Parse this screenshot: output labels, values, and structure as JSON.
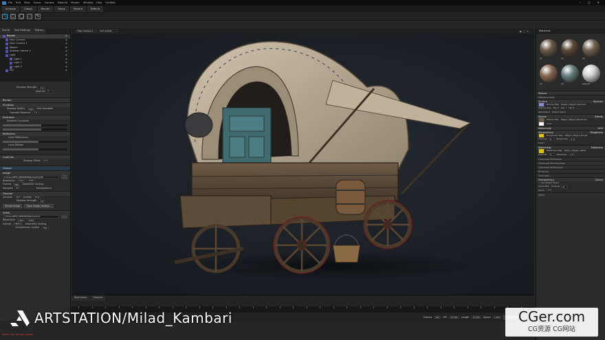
{
  "app": {
    "menu": [
      "File",
      "Edit",
      "View",
      "Scene",
      "Camera",
      "Material",
      "Render",
      "Window",
      "Help",
      "Untitled"
    ],
    "tabs": [
      "Animate",
      "Classic",
      "Render",
      "Setup",
      "Texture",
      "Default"
    ]
  },
  "left_panel": {
    "tabs": [
      "Scene",
      "Tool Settings",
      "History"
    ],
    "tree": [
      {
        "label": "Render",
        "selected": true
      },
      {
        "label": "Main Camera",
        "selected": false
      },
      {
        "label": "Main Camera 1",
        "selected": false
      },
      {
        "label": "Wagon",
        "selected": false
      },
      {
        "label": "Shadow Catcher 1",
        "selected": false
      },
      {
        "label": "Light",
        "selected": false
      },
      {
        "label": "Light 1",
        "selected": false
      },
      {
        "label": "Light 2",
        "selected": false
      },
      {
        "label": "Light 3",
        "selected": false
      },
      {
        "label": "Sky",
        "selected": false
      }
    ],
    "denoise": {
      "label": "Denoise Strength",
      "value": "1.0",
      "start_label": "Start At",
      "start_value": "1"
    },
    "sections": {
      "render": "Render",
      "shadows": "Shadows",
      "exclusion": "Exclusion",
      "reflection": "Reflection",
      "common": "Common",
      "output": "Output",
      "image": "Image",
      "video": "Video"
    },
    "shadow_quality": {
      "label": "Shadow Quality",
      "value": "High",
      "check": "Use Cascades"
    },
    "cascade": {
      "label": "Cascade Distance",
      "value": "1.0"
    },
    "ambient": "Ambient Occlusion",
    "local_refl": "Local Reflections",
    "local_diffuse": "Local Diffuse",
    "shadow_offset": {
      "label": "Shadow Offset",
      "value": "0.0"
    },
    "output_path": "C:/Users/EFM_RENDERING/Desktop/Mi",
    "resolution": {
      "label": "Resolution",
      "w": "1920",
      "h": "1080"
    },
    "format": {
      "label": "Format",
      "value": "PNG",
      "check": "Geometric Sorting"
    },
    "samples": {
      "label": "Samples",
      "value": "64",
      "check": "Transparency"
    },
    "denoise_row": {
      "label": "Denoise",
      "device": "CPU",
      "quality_label": "Quality",
      "quality": "High"
    },
    "denoise_strength": {
      "label": "Denoise Strength",
      "value": "1.0"
    },
    "buttons": {
      "render_image": "Render Image",
      "open_location": "Open Image Location..."
    },
    "video_path": "C:/Users/EFM_RENDERING/Desktop",
    "video_res": {
      "label": "Resolution",
      "w": "1920",
      "h": "1080"
    },
    "video_format": {
      "label": "Format",
      "value": "MPEG4",
      "check": "Geometric Sorting"
    },
    "compression": {
      "label": "Compression Quality",
      "value": "High"
    }
  },
  "viewport": {
    "camera": "Main Camera 1",
    "quality": "Full Quality"
  },
  "timeline": {
    "tabs": [
      "Keyframes",
      "Timeline"
    ],
    "frames_label": "Frames",
    "frames": "300",
    "fps_label": "FPS",
    "fps": "30.000",
    "length_label": "Length",
    "length": "10.000",
    "speed_label": "Speed",
    "speed": "1.000",
    "bake": "Bake Speed"
  },
  "right_panel": {
    "title": "Materials",
    "materials": [
      {
        "label": "01",
        "color": "#6b5a4a"
      },
      {
        "label": "02",
        "color": "#5c4a3a"
      },
      {
        "label": "03",
        "color": "#736252"
      },
      {
        "label": "04",
        "color": "#8a6a55"
      },
      {
        "label": "05",
        "color": "#6a8080"
      },
      {
        "label": "Default",
        "color": "#d0d0d0"
      }
    ],
    "sections": [
      {
        "label": "Texture",
        "value": "",
        "dim": false
      },
      {
        "label": "Displacement",
        "value": "",
        "dim": true
      },
      {
        "label": "Surface",
        "value": "Normals",
        "dim": false
      },
      {
        "label": "Albedo",
        "value": "Albedo",
        "dim": false
      },
      {
        "label": "Reflectivity",
        "value": "GGX",
        "dim": false
      },
      {
        "label": "Microsurface",
        "value": "Roughness",
        "dim": false
      },
      {
        "label": "Reflectivity",
        "value": "Metalness",
        "dim": false
      },
      {
        "label": "Clearcoat Reflection",
        "value": "",
        "dim": true
      },
      {
        "label": "Clearcoat Microsurface",
        "value": "",
        "dim": true
      },
      {
        "label": "Clearcoat Reflectivity",
        "value": "",
        "dim": true
      },
      {
        "label": "Emissive",
        "value": "",
        "dim": true
      },
      {
        "label": "Occlusion",
        "value": "",
        "dim": true
      },
      {
        "label": "Transparency",
        "value": "Cutout",
        "dim": false
      },
      {
        "label": "Extra",
        "value": "",
        "dim": true
      }
    ],
    "normal_map": {
      "label": "Normal Map",
      "file": "Wagon_Wagon_Normal.t"
    },
    "albedo_map": {
      "label": "Albedo Map",
      "file": "Wagon_Wagon_BaseColor"
    },
    "roughness_map": {
      "label": "Roughness Map",
      "file": "Wagon_Wagon_Rough"
    },
    "metalness_map": {
      "label": "Metalness Map",
      "file": "Wagon_Wagon_Metal"
    },
    "alpha": "Use Albedo Alpha",
    "alpha_map": "Alpha Map",
    "roughness_label": "Roughness",
    "metalness_label": "Metalness",
    "alpha_label": "Alpha",
    "channel_label": "Channel",
    "channel": "R",
    "invert": "Invert",
    "color": "Color",
    "scale_bias": "Scale & Bias",
    "flip_x": "Flip X",
    "flip_y": "Flip Y",
    "flip_z": "Flip Z",
    "generate_z": "Generate Z",
    "object_space": "Object Space",
    "value_one": "1.0"
  },
  "watermarks": {
    "artstation": "ARTSTATION/Milad_Kambari",
    "cger_big": "CGer.com",
    "cger_small": "CG资源 CG网站"
  },
  "status": "Scene has not been saved"
}
